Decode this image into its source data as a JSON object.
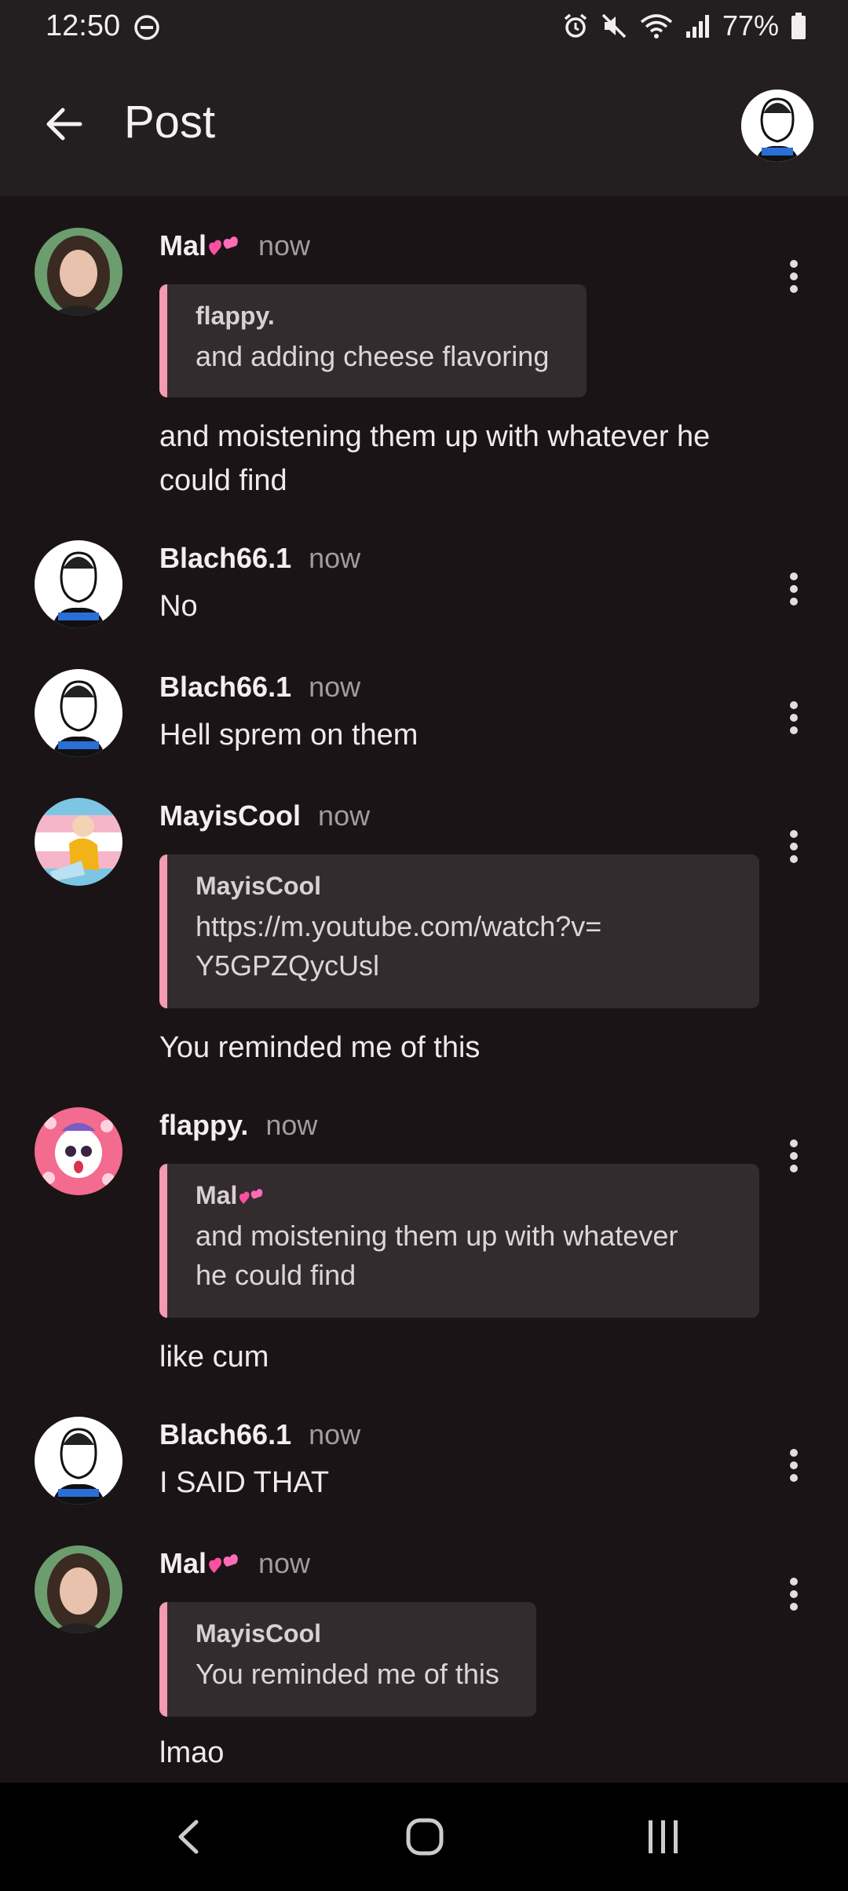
{
  "status_bar": {
    "time": "12:50",
    "battery": "77%"
  },
  "app_bar": {
    "title": "Post"
  },
  "messages": [
    {
      "author": "Mal",
      "time": "now",
      "quote": {
        "author": "flappy.",
        "text": "and adding cheese flavoring"
      },
      "text": "and moistening them up with whatever he could find"
    },
    {
      "author": "Blach66.1",
      "time": "now",
      "text": "No"
    },
    {
      "author": "Blach66.1",
      "time": "now",
      "text": "Hell sprem on them"
    },
    {
      "author": "MayisCool",
      "time": "now",
      "quote": {
        "author": "MayisCool",
        "text": "https://m.youtube.com/watch?v=Y5GPZQycUsl"
      },
      "text": "You reminded me of this"
    },
    {
      "author": "flappy.",
      "time": "now",
      "quote": {
        "author": "Mal",
        "text": "and moistening them up with whatever he could find"
      },
      "text": "like cum"
    },
    {
      "author": "Blach66.1",
      "time": "now",
      "text": "I SAID THAT"
    },
    {
      "author": "Mal",
      "time": "now",
      "quote": {
        "author": "MayisCool",
        "text": "You reminded me of this"
      },
      "text": "lmao"
    }
  ],
  "colors": {
    "background": "#1a1416",
    "bar": "#231e20",
    "quote_bg": "#332c2f",
    "quote_accent": "#f29bb1",
    "timestamp": "#a59a9e"
  },
  "icons": [
    "back-arrow-icon",
    "more-vert-icon",
    "alarm-icon",
    "mute-icon",
    "wifi-icon",
    "signal-icon",
    "battery-icon",
    "nav-back-icon",
    "nav-home-icon",
    "nav-recents-icon"
  ]
}
